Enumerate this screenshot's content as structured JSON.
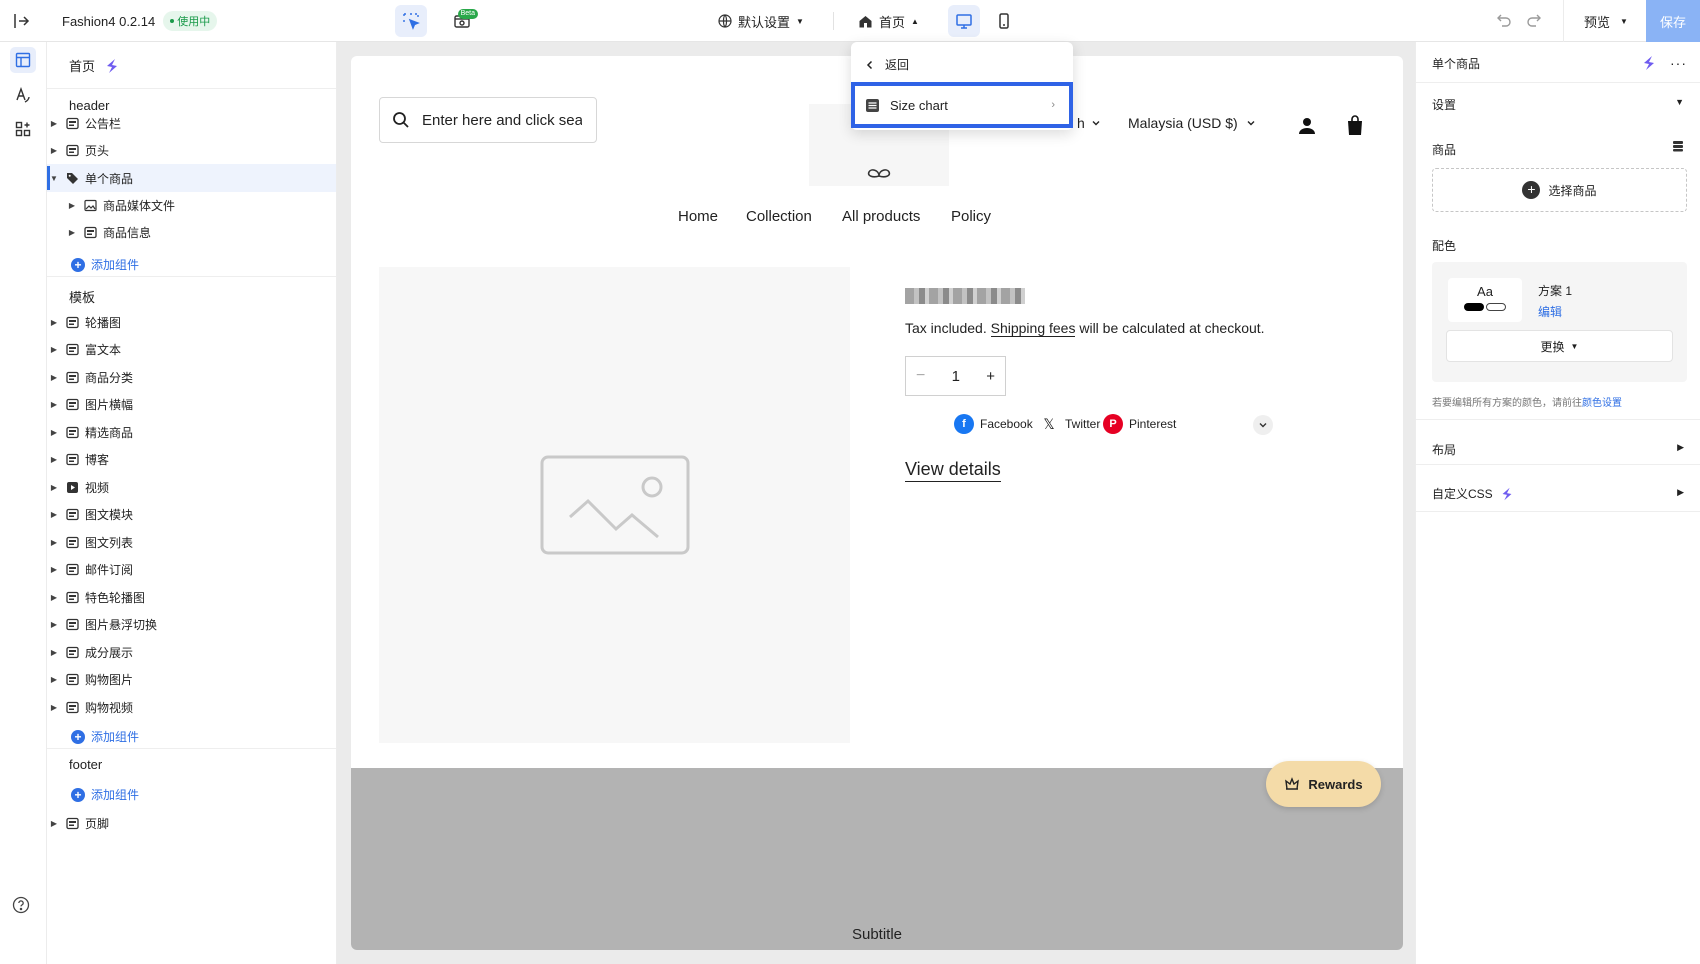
{
  "topbar": {
    "app_name": "Fashion4 0.2.14",
    "status_badge": "使用中",
    "beta_label": "Beta",
    "language_select": "默认设置",
    "page_select": "首页",
    "preview_label": "预览",
    "save_label": "保存",
    "device_active": "desktop"
  },
  "sidebar": {
    "page_title": "首页",
    "header_section": "header",
    "header_items": [
      {
        "label": "公告栏",
        "icon": "announcement-icon"
      },
      {
        "label": "页头",
        "icon": "header-icon"
      },
      {
        "label": "单个商品",
        "icon": "tag-icon",
        "selected": true,
        "expanded": true
      }
    ],
    "product_children": [
      {
        "label": "商品媒体文件",
        "icon": "image-icon"
      },
      {
        "label": "商品信息",
        "icon": "info-block-icon"
      }
    ],
    "add_component": "添加组件",
    "template_section": "模板",
    "template_items": [
      {
        "label": "轮播图",
        "icon": "slideshow-icon"
      },
      {
        "label": "富文本",
        "icon": "rich-text-icon"
      },
      {
        "label": "商品分类",
        "icon": "collection-icon"
      },
      {
        "label": "图片横幅",
        "icon": "image-banner-icon"
      },
      {
        "label": "精选商品",
        "icon": "featured-product-icon"
      },
      {
        "label": "博客",
        "icon": "blog-icon"
      },
      {
        "label": "视频",
        "icon": "video-icon"
      },
      {
        "label": "图文模块",
        "icon": "image-text-icon"
      },
      {
        "label": "图文列表",
        "icon": "image-list-icon"
      },
      {
        "label": "邮件订阅",
        "icon": "newsletter-icon"
      },
      {
        "label": "特色轮播图",
        "icon": "featured-slideshow-icon"
      },
      {
        "label": "图片悬浮切换",
        "icon": "image-hover-icon"
      },
      {
        "label": "成分展示",
        "icon": "ingredients-icon"
      },
      {
        "label": "购物图片",
        "icon": "shoppable-image-icon"
      },
      {
        "label": "购物视频",
        "icon": "shoppable-video-icon"
      }
    ],
    "footer_section": "footer",
    "footer_items": [
      {
        "label": "页脚",
        "icon": "footer-icon"
      }
    ]
  },
  "dropdown": {
    "back_label": "返回",
    "item_label": "Size chart"
  },
  "storefront": {
    "search_placeholder": "Enter here and click sea",
    "language_fragment": "h",
    "currency": "Malaysia (USD $)",
    "nav": [
      "Home",
      "Collection",
      "All products",
      "Policy"
    ],
    "tax_prefix": "Tax included. ",
    "tax_link": "Shipping fees",
    "tax_suffix": " will be calculated at checkout.",
    "quantity": "1",
    "share": [
      {
        "label": "Facebook",
        "color": "#1877f2"
      },
      {
        "label": "Twitter",
        "color": "#000000"
      },
      {
        "label": "Pinterest",
        "color": "#e60023"
      }
    ],
    "view_details": "View details",
    "band_subtitle": "Subtitle",
    "rewards_label": "Rewards"
  },
  "right_panel": {
    "title": "单个商品",
    "settings": "设置",
    "product_label": "商品",
    "pick_product": "选择商品",
    "color_label": "配色",
    "swatch_text": "Aa",
    "scheme_name": "方案 1",
    "scheme_edit": "编辑",
    "change_label": "更换",
    "color_note_prefix": "若要编辑所有方案的颜色，请前往",
    "color_note_link": "颜色设置",
    "layout_label": "布局",
    "custom_css": "自定义CSS"
  },
  "colors": {
    "accent": "#2f6fe4",
    "save_button": "#8ab3f5",
    "highlight_border": "#2f63e6",
    "rewards_bg": "#f4dba8",
    "active_badge": "#1a9a4a"
  }
}
